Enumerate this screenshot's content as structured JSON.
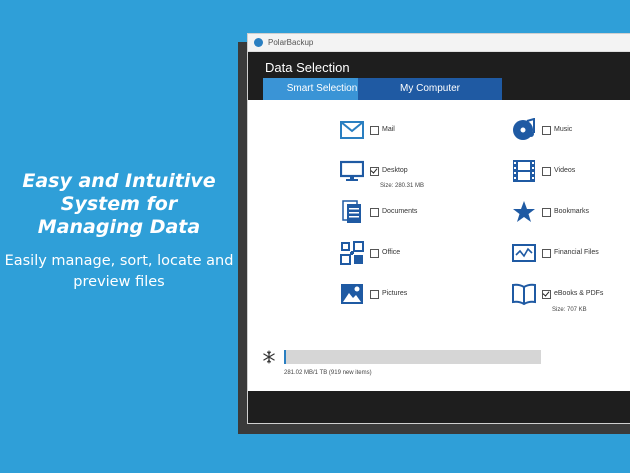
{
  "promo": {
    "title": "Easy and Intuitive System for Managing Data",
    "subtitle": "Easily manage, sort, locate and preview files"
  },
  "app": {
    "window_title": "PolarBackup",
    "section_title": "Data Selection",
    "tabs": [
      {
        "label": "Smart Selection",
        "active": true
      },
      {
        "label": "My Computer",
        "active": false
      }
    ]
  },
  "categories": [
    {
      "label": "Mail",
      "checked": false,
      "icon": "mail-icon"
    },
    {
      "label": "Music",
      "checked": false,
      "icon": "music-icon"
    },
    {
      "label": "Desktop",
      "checked": true,
      "size": "Size: 280.31 MB",
      "icon": "desktop-icon"
    },
    {
      "label": "Videos",
      "checked": false,
      "icon": "video-icon"
    },
    {
      "label": "Documents",
      "checked": false,
      "icon": "documents-icon"
    },
    {
      "label": "Bookmarks",
      "checked": false,
      "icon": "star-icon"
    },
    {
      "label": "Office",
      "checked": false,
      "icon": "office-icon"
    },
    {
      "label": "Financial Files",
      "checked": false,
      "icon": "chart-icon"
    },
    {
      "label": "Pictures",
      "checked": false,
      "icon": "picture-icon"
    },
    {
      "label": "eBooks & PDFs",
      "checked": true,
      "size": "Size: 707 KB",
      "icon": "book-icon"
    }
  ],
  "storage": {
    "text": "281.02 MB/1 TB (919 new items)",
    "used_fraction": 0.0003
  },
  "colors": {
    "background": "#2f9fd8",
    "accent": "#2a7fc1",
    "header": "#1e1e1e"
  }
}
